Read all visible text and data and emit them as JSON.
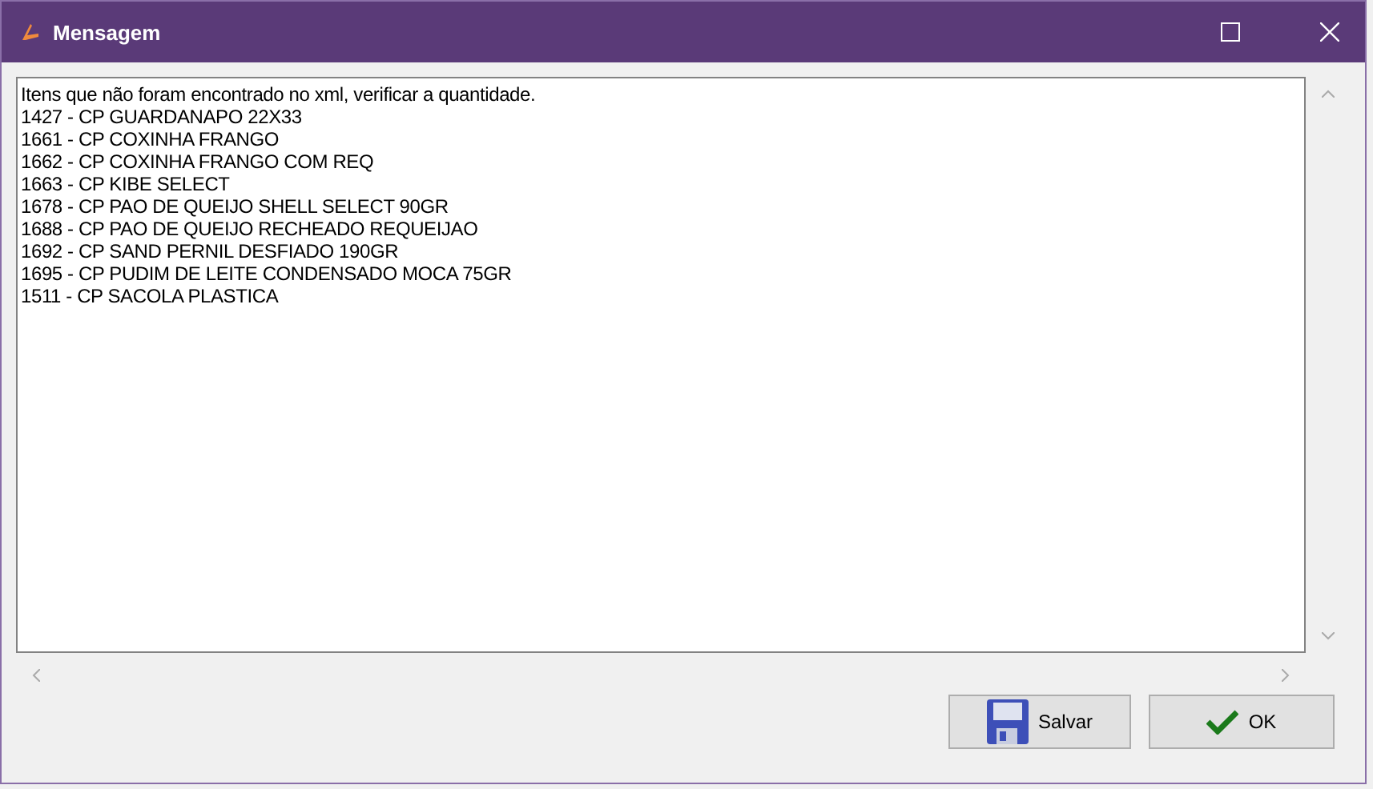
{
  "window": {
    "title": "Mensagem"
  },
  "message": {
    "lines": [
      "Itens que não foram encontrado no xml, verificar a quantidade.",
      "1427 - CP GUARDANAPO 22X33",
      "1661 - CP COXINHA FRANGO",
      "1662 - CP COXINHA FRANGO COM REQ",
      "1663 - CP KIBE SELECT",
      "1678 - CP PAO DE QUEIJO SHELL SELECT 90GR",
      "1688 - CP PAO DE QUEIJO RECHEADO REQUEIJAO",
      "1692 - CP SAND PERNIL DESFIADO 190GR",
      "1695 - CP PUDIM DE LEITE CONDENSADO MOCA 75GR",
      "1511 - CP SACOLA PLASTICA"
    ]
  },
  "buttons": [
    {
      "kind": "save",
      "label": "Salvar"
    },
    {
      "kind": "ok",
      "label": "OK"
    }
  ]
}
